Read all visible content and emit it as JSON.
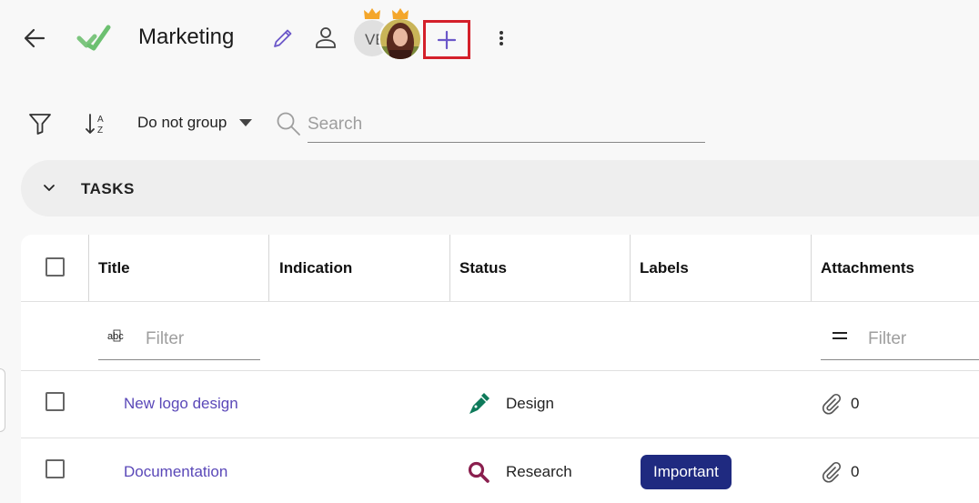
{
  "header": {
    "title": "Marketing",
    "avatar_initials": "VE",
    "colors": {
      "check": "#6cc070",
      "accent": "#6b57c9",
      "highlight": "#d4202a",
      "crown": "#f4a62a"
    }
  },
  "toolbar": {
    "group_value": "Do not group",
    "search_placeholder": "Search"
  },
  "section": {
    "label": "TASKS"
  },
  "table": {
    "columns": [
      "Title",
      "Indication",
      "Status",
      "Labels",
      "Attachments"
    ],
    "filter_placeholder": "Filter",
    "rows": [
      {
        "title": "New logo design",
        "status": "Design",
        "status_icon": "pen-icon",
        "label": "",
        "attachments": "0"
      },
      {
        "title": "Documentation",
        "status": "Research",
        "status_icon": "magnifier-icon",
        "label": "Important",
        "attachments": "0"
      }
    ],
    "colors": {
      "link": "#5a48b8",
      "badge": "#1f2a80",
      "design_icon": "#0e7a5a",
      "research_icon": "#8a1f4e"
    }
  }
}
